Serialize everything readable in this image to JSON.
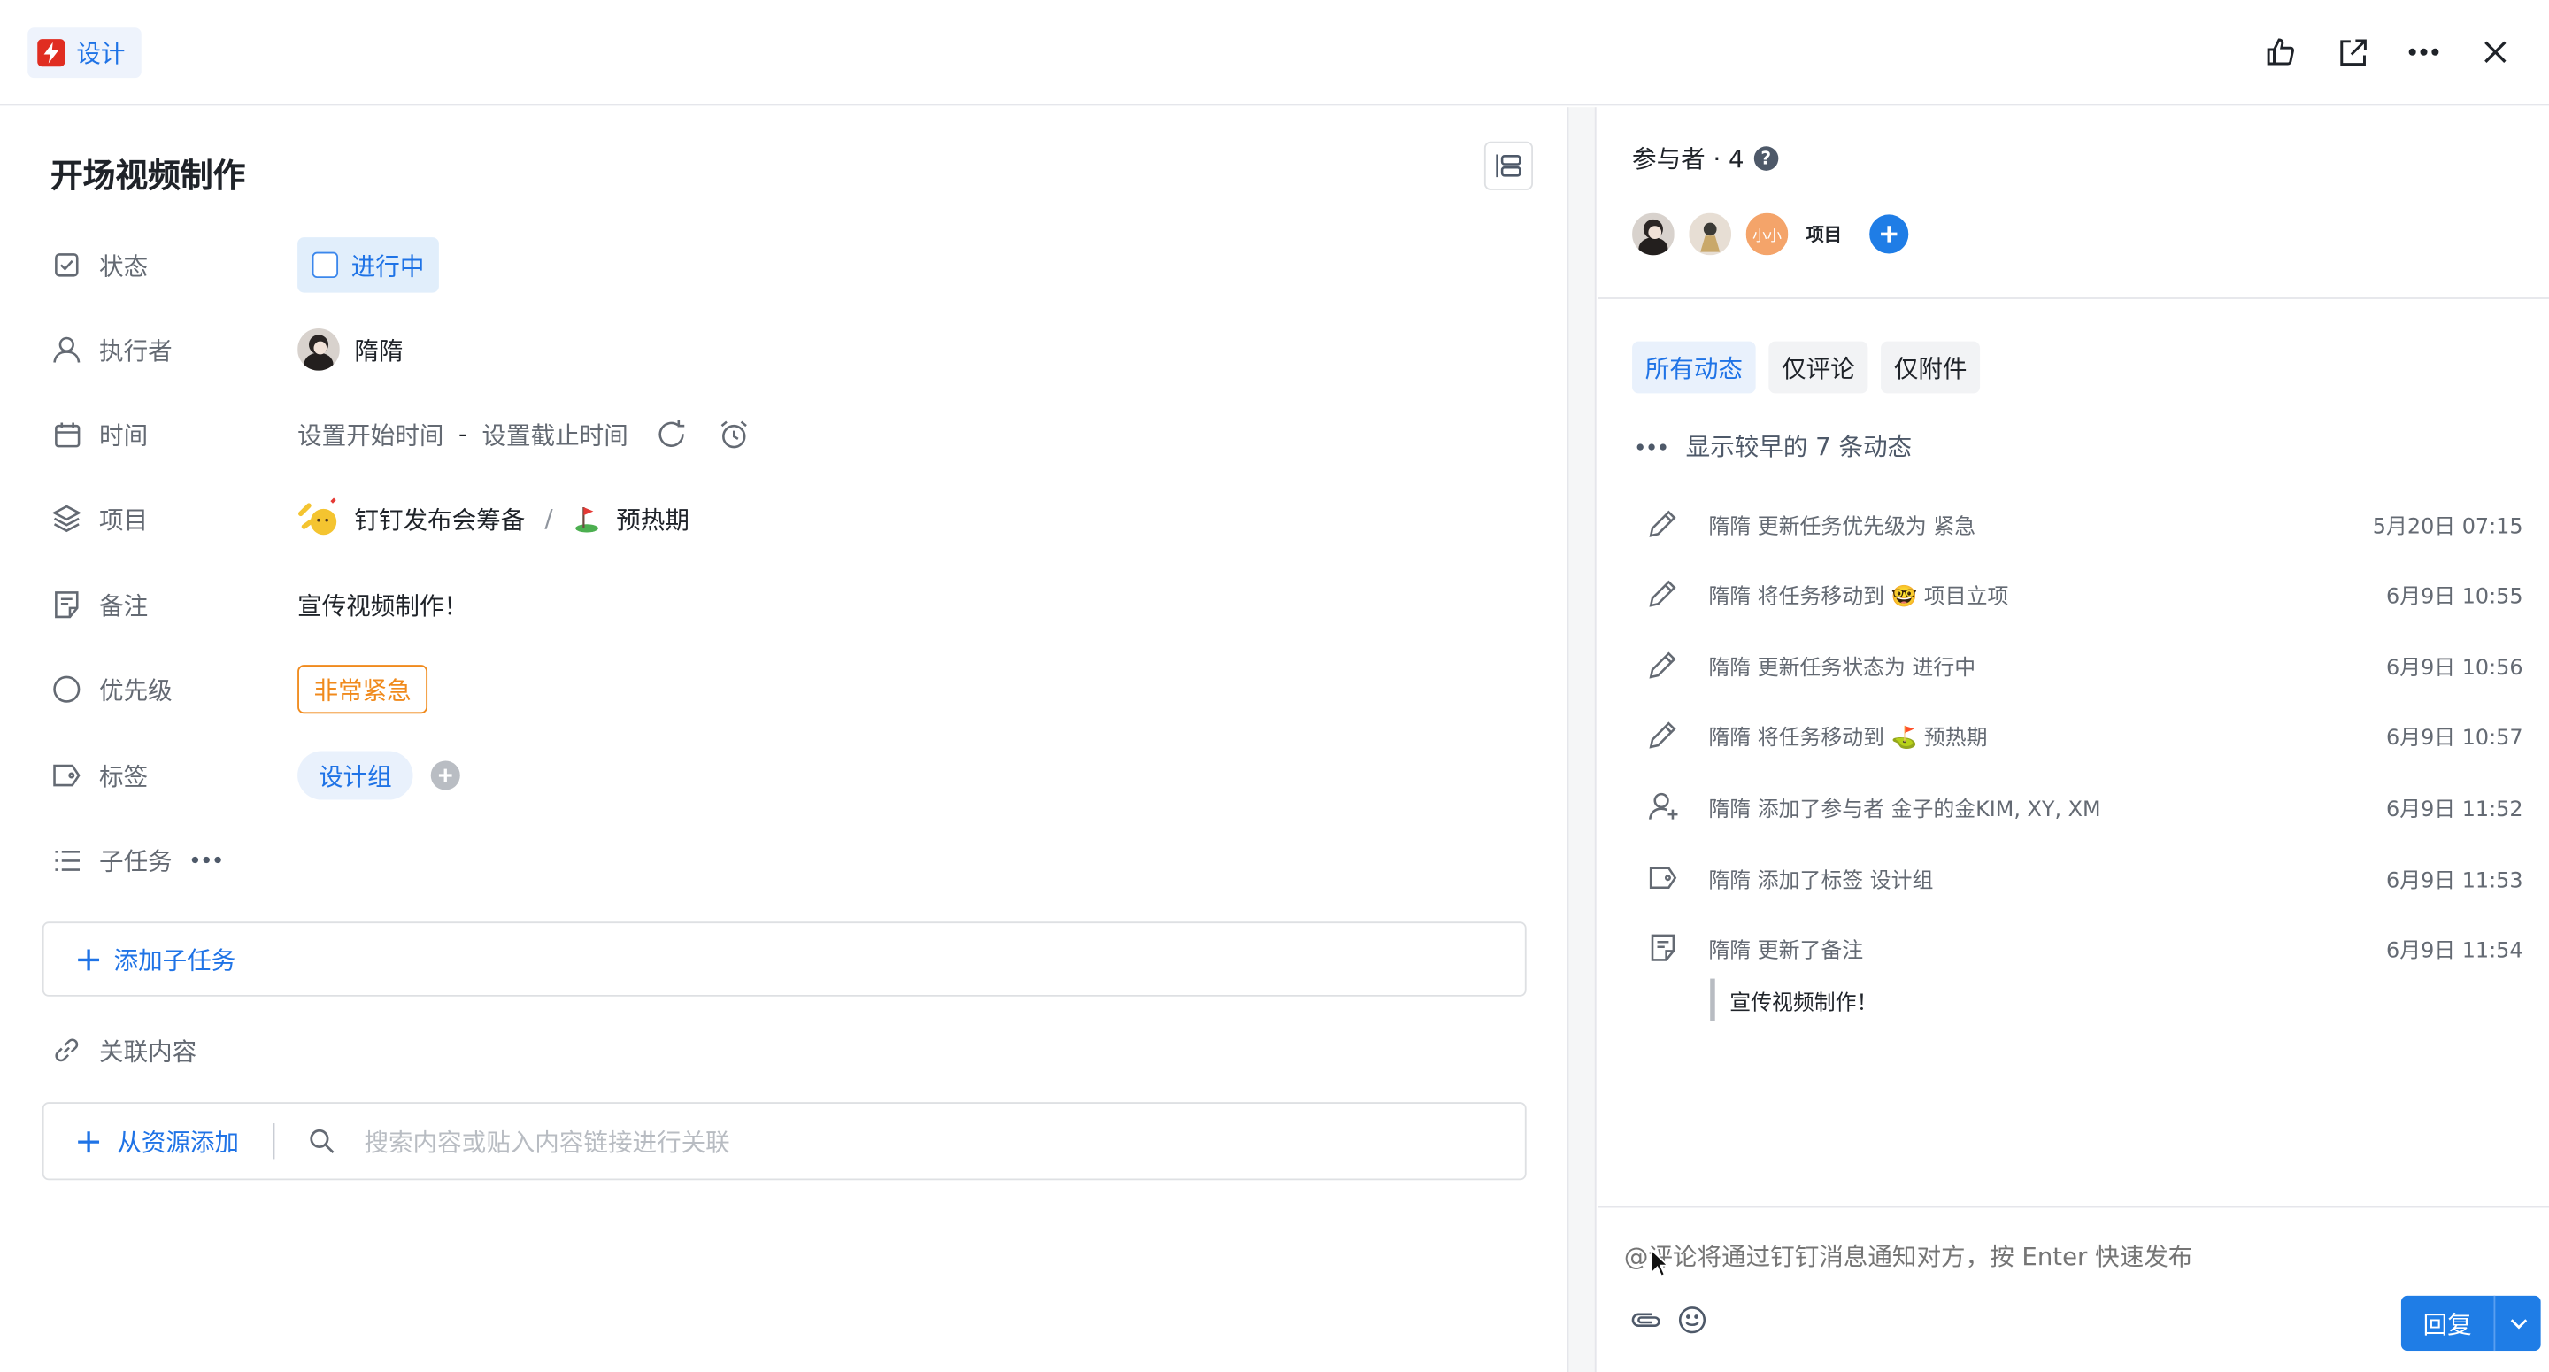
{
  "header": {
    "app_label": "设计",
    "actions": [
      "like-icon",
      "open-external-icon",
      "more-icon",
      "close-icon"
    ]
  },
  "task": {
    "title": "开场视频制作",
    "fields": {
      "status": {
        "label": "状态",
        "value": "进行中"
      },
      "assignee": {
        "label": "执行者",
        "value": "隋隋"
      },
      "time": {
        "label": "时间",
        "start_placeholder": "设置开始时间",
        "separator": "-",
        "end_placeholder": "设置截止时间"
      },
      "project": {
        "label": "项目",
        "project_name": "钉钉发布会筹备",
        "separator": "/",
        "stage_name": "预热期"
      },
      "note": {
        "label": "备注",
        "value": "宣传视频制作！"
      },
      "priority": {
        "label": "优先级",
        "value": "非常紧急"
      },
      "tags": {
        "label": "标签",
        "value": "设计组"
      },
      "subtasks": {
        "label": "子任务"
      }
    },
    "add_subtask_label": "添加子任务",
    "related": {
      "label": "关联内容",
      "add_from_resource": "从资源添加",
      "search_placeholder": "搜索内容或贴入内容链接进行关联"
    }
  },
  "participants": {
    "title": "参与者 · 4",
    "help_glyph": "?",
    "project_label": "项目"
  },
  "activity": {
    "tabs": [
      {
        "label": "所有动态",
        "active": true
      },
      {
        "label": "仅评论",
        "active": false
      },
      {
        "label": "仅附件",
        "active": false
      }
    ],
    "show_earlier": "显示较早的 7 条动态",
    "items": [
      {
        "icon": "pencil-icon",
        "text": "隋隋 更新任务优先级为 紧急",
        "time": "5月20日 07:15"
      },
      {
        "icon": "pencil-icon",
        "text": "隋隋 将任务移动到 🤓 项目立项",
        "time": "6月9日 10:55"
      },
      {
        "icon": "pencil-icon",
        "text": "隋隋 更新任务状态为 进行中",
        "time": "6月9日 10:56"
      },
      {
        "icon": "pencil-icon",
        "text": "隋隋 将任务移动到 ⛳ 预热期",
        "time": "6月9日 10:57"
      },
      {
        "icon": "add-user-icon",
        "text": "隋隋 添加了参与者 金子的金KIM, XY, XM",
        "time": "6月9日 11:52"
      },
      {
        "icon": "tag-icon",
        "text": "隋隋 添加了标签 设计组",
        "time": "6月9日 11:53"
      },
      {
        "icon": "note-icon",
        "text": "隋隋 更新了备注",
        "time": "6月9日 11:54"
      }
    ],
    "note_quote": "宣传视频制作！"
  },
  "comment": {
    "placeholder": "@评论将通过钉钉消息通知对方，按 Enter 快速发布",
    "reply_label": "回复"
  },
  "colors": {
    "accent": "#1f73e6",
    "priority": "#f08a1c",
    "app_logo": "#e02d21"
  }
}
